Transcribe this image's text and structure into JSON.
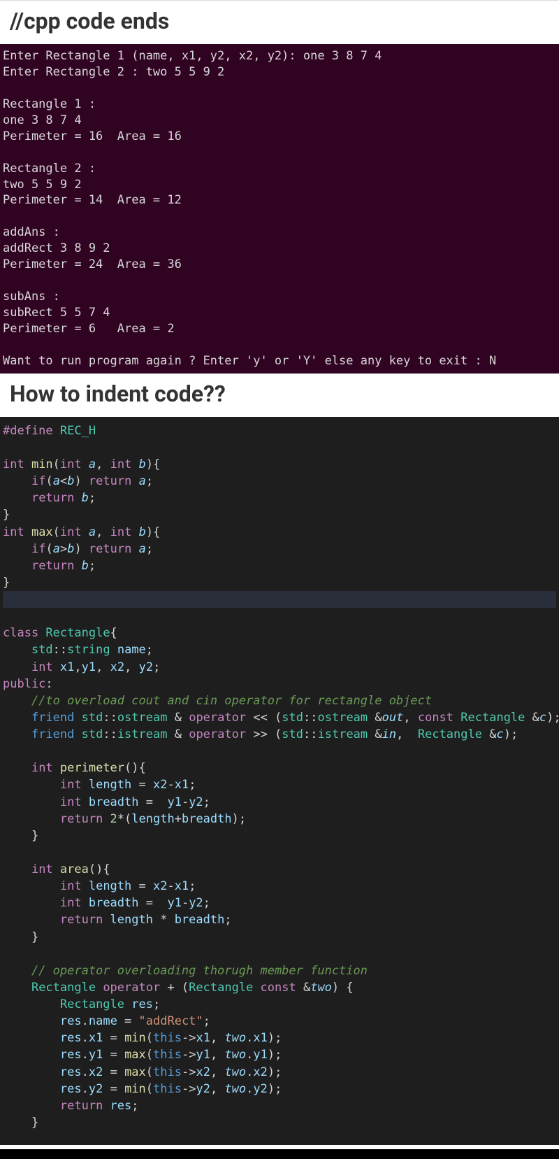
{
  "heading1": "//cpp code ends",
  "heading2": "How to indent code??",
  "terminal": {
    "lines": [
      "Enter Rectangle 1 (name, x1, y2, x2, y2): one 3 8 7 4",
      "Enter Rectangle 2 : two 5 5 9 2",
      "",
      "Rectangle 1 :",
      "one 3 8 7 4",
      "Perimeter = 16  Area = 16",
      "",
      "Rectangle 2 :",
      "two 5 5 9 2",
      "Perimeter = 14  Area = 12",
      "",
      "addAns :",
      "addRect 3 8 9 2",
      "Perimeter = 24  Area = 36",
      "",
      "subAns :",
      "subRect 5 5 7 4",
      "Perimeter = 6   Area = 2",
      "",
      "Want to run program again ? Enter 'y' or 'Y' else any key to exit : N"
    ]
  },
  "code": {
    "tokens": [
      [
        [
          "c-define",
          "#define "
        ],
        [
          "c-macro",
          "REC_H"
        ]
      ],
      [
        [
          "",
          ""
        ]
      ],
      [
        [
          "c-keyword",
          "int "
        ],
        [
          "c-func",
          "min"
        ],
        [
          "c-punct",
          "("
        ],
        [
          "c-keyword",
          "int "
        ],
        [
          "c-param",
          "a"
        ],
        [
          "c-punct",
          ", "
        ],
        [
          "c-keyword",
          "int "
        ],
        [
          "c-param",
          "b"
        ],
        [
          "c-punct",
          "){"
        ]
      ],
      [
        [
          "",
          "    "
        ],
        [
          "c-keyword",
          "if"
        ],
        [
          "c-punct",
          "("
        ],
        [
          "c-param",
          "a"
        ],
        [
          "c-op",
          "<"
        ],
        [
          "c-param",
          "b"
        ],
        [
          "c-punct",
          ") "
        ],
        [
          "c-keyword",
          "return "
        ],
        [
          "c-param",
          "a"
        ],
        [
          "c-punct",
          ";"
        ]
      ],
      [
        [
          "",
          "    "
        ],
        [
          "c-keyword",
          "return "
        ],
        [
          "c-param",
          "b"
        ],
        [
          "c-punct",
          ";"
        ]
      ],
      [
        [
          "c-punct",
          "}"
        ]
      ],
      [
        [
          "c-keyword",
          "int "
        ],
        [
          "c-func",
          "max"
        ],
        [
          "c-punct",
          "("
        ],
        [
          "c-keyword",
          "int "
        ],
        [
          "c-param",
          "a"
        ],
        [
          "c-punct",
          ", "
        ],
        [
          "c-keyword",
          "int "
        ],
        [
          "c-param",
          "b"
        ],
        [
          "c-punct",
          "){"
        ]
      ],
      [
        [
          "",
          "    "
        ],
        [
          "c-keyword",
          "if"
        ],
        [
          "c-punct",
          "("
        ],
        [
          "c-param",
          "a"
        ],
        [
          "c-op",
          ">"
        ],
        [
          "c-param",
          "b"
        ],
        [
          "c-punct",
          ") "
        ],
        [
          "c-keyword",
          "return "
        ],
        [
          "c-param",
          "a"
        ],
        [
          "c-punct",
          ";"
        ]
      ],
      [
        [
          "",
          "    "
        ],
        [
          "c-keyword",
          "return "
        ],
        [
          "c-param",
          "b"
        ],
        [
          "c-punct",
          ";"
        ]
      ],
      [
        [
          "c-punct",
          "}"
        ]
      ],
      [
        [
          "hl-line",
          ""
        ]
      ],
      [
        [
          "c-keyword",
          "class "
        ],
        [
          "c-type",
          "Rectangle"
        ],
        [
          "c-punct",
          "{"
        ]
      ],
      [
        [
          "",
          "    "
        ],
        [
          "c-ns",
          "std"
        ],
        [
          "c-punct",
          "::"
        ],
        [
          "c-type",
          "string"
        ],
        [
          "",
          " "
        ],
        [
          "c-var",
          "name"
        ],
        [
          "c-punct",
          ";"
        ]
      ],
      [
        [
          "",
          "    "
        ],
        [
          "c-keyword",
          "int "
        ],
        [
          "c-var",
          "x1"
        ],
        [
          "c-punct",
          ","
        ],
        [
          "c-var",
          "y1"
        ],
        [
          "c-punct",
          ", "
        ],
        [
          "c-var",
          "x2"
        ],
        [
          "c-punct",
          ", "
        ],
        [
          "c-var",
          "y2"
        ],
        [
          "c-punct",
          ";"
        ]
      ],
      [
        [
          "c-keyword",
          "public"
        ],
        [
          "c-punct",
          ":"
        ]
      ],
      [
        [
          "",
          "    "
        ],
        [
          "c-comment",
          "//to overload cout and cin operator for rectangle object"
        ]
      ],
      [
        [
          "",
          "    "
        ],
        [
          "c-friend",
          "friend "
        ],
        [
          "c-ns",
          "std"
        ],
        [
          "c-punct",
          "::"
        ],
        [
          "c-type",
          "ostream"
        ],
        [
          "",
          " "
        ],
        [
          "c-op",
          "& "
        ],
        [
          "c-keyword",
          "operator "
        ],
        [
          "c-op",
          "<< "
        ],
        [
          "c-punct",
          "("
        ],
        [
          "c-ns",
          "std"
        ],
        [
          "c-punct",
          "::"
        ],
        [
          "c-type",
          "ostream"
        ],
        [
          "",
          " "
        ],
        [
          "c-op",
          "&"
        ],
        [
          "c-param",
          "out"
        ],
        [
          "c-punct",
          ", "
        ],
        [
          "c-keyword",
          "const "
        ],
        [
          "c-type",
          "Rectangle"
        ],
        [
          "",
          " "
        ],
        [
          "c-op",
          "&"
        ],
        [
          "c-param",
          "c"
        ],
        [
          "c-punct",
          ");"
        ]
      ],
      [
        [
          "",
          "    "
        ],
        [
          "c-friend",
          "friend "
        ],
        [
          "c-ns",
          "std"
        ],
        [
          "c-punct",
          "::"
        ],
        [
          "c-type",
          "istream"
        ],
        [
          "",
          " "
        ],
        [
          "c-op",
          "& "
        ],
        [
          "c-keyword",
          "operator "
        ],
        [
          "c-op",
          ">> "
        ],
        [
          "c-punct",
          "("
        ],
        [
          "c-ns",
          "std"
        ],
        [
          "c-punct",
          "::"
        ],
        [
          "c-type",
          "istream"
        ],
        [
          "",
          " "
        ],
        [
          "c-op",
          "&"
        ],
        [
          "c-param",
          "in"
        ],
        [
          "c-punct",
          ",  "
        ],
        [
          "c-type",
          "Rectangle"
        ],
        [
          "",
          " "
        ],
        [
          "c-op",
          "&"
        ],
        [
          "c-param",
          "c"
        ],
        [
          "c-punct",
          ");"
        ]
      ],
      [
        [
          "",
          ""
        ]
      ],
      [
        [
          "",
          "    "
        ],
        [
          "c-keyword",
          "int "
        ],
        [
          "c-func",
          "perimeter"
        ],
        [
          "c-punct",
          "(){"
        ]
      ],
      [
        [
          "",
          "        "
        ],
        [
          "c-keyword",
          "int "
        ],
        [
          "c-var",
          "length"
        ],
        [
          "c-op",
          " = "
        ],
        [
          "c-var",
          "x2"
        ],
        [
          "c-op",
          "-"
        ],
        [
          "c-var",
          "x1"
        ],
        [
          "c-punct",
          ";"
        ]
      ],
      [
        [
          "",
          "        "
        ],
        [
          "c-keyword",
          "int "
        ],
        [
          "c-var",
          "breadth"
        ],
        [
          "c-op",
          " =  "
        ],
        [
          "c-var",
          "y1"
        ],
        [
          "c-op",
          "-"
        ],
        [
          "c-var",
          "y2"
        ],
        [
          "c-punct",
          ";"
        ]
      ],
      [
        [
          "",
          "        "
        ],
        [
          "c-keyword",
          "return "
        ],
        [
          "c-num",
          "2"
        ],
        [
          "c-op",
          "*"
        ],
        [
          "c-punct",
          "("
        ],
        [
          "c-var",
          "length"
        ],
        [
          "c-op",
          "+"
        ],
        [
          "c-var",
          "breadth"
        ],
        [
          "c-punct",
          ");"
        ]
      ],
      [
        [
          "",
          "    "
        ],
        [
          "c-punct",
          "}"
        ]
      ],
      [
        [
          "",
          ""
        ]
      ],
      [
        [
          "",
          "    "
        ],
        [
          "c-keyword",
          "int "
        ],
        [
          "c-func",
          "area"
        ],
        [
          "c-punct",
          "(){"
        ]
      ],
      [
        [
          "",
          "        "
        ],
        [
          "c-keyword",
          "int "
        ],
        [
          "c-var",
          "length"
        ],
        [
          "c-op",
          " = "
        ],
        [
          "c-var",
          "x2"
        ],
        [
          "c-op",
          "-"
        ],
        [
          "c-var",
          "x1"
        ],
        [
          "c-punct",
          ";"
        ]
      ],
      [
        [
          "",
          "        "
        ],
        [
          "c-keyword",
          "int "
        ],
        [
          "c-var",
          "breadth"
        ],
        [
          "c-op",
          " =  "
        ],
        [
          "c-var",
          "y1"
        ],
        [
          "c-op",
          "-"
        ],
        [
          "c-var",
          "y2"
        ],
        [
          "c-punct",
          ";"
        ]
      ],
      [
        [
          "",
          "        "
        ],
        [
          "c-keyword",
          "return "
        ],
        [
          "c-var",
          "length"
        ],
        [
          "c-op",
          " * "
        ],
        [
          "c-var",
          "breadth"
        ],
        [
          "c-punct",
          ";"
        ]
      ],
      [
        [
          "",
          "    "
        ],
        [
          "c-punct",
          "}"
        ]
      ],
      [
        [
          "",
          ""
        ]
      ],
      [
        [
          "",
          "    "
        ],
        [
          "c-comment",
          "// operator overloading thorugh member function"
        ]
      ],
      [
        [
          "",
          "    "
        ],
        [
          "c-type",
          "Rectangle "
        ],
        [
          "c-keyword",
          "operator "
        ],
        [
          "c-op",
          "+ "
        ],
        [
          "c-punct",
          "("
        ],
        [
          "c-type",
          "Rectangle "
        ],
        [
          "c-keyword",
          "const "
        ],
        [
          "c-op",
          "&"
        ],
        [
          "c-param",
          "two"
        ],
        [
          "c-punct",
          ") {"
        ]
      ],
      [
        [
          "",
          "        "
        ],
        [
          "c-type",
          "Rectangle "
        ],
        [
          "c-var",
          "res"
        ],
        [
          "c-punct",
          ";"
        ]
      ],
      [
        [
          "",
          "        "
        ],
        [
          "c-var",
          "res"
        ],
        [
          "c-punct",
          "."
        ],
        [
          "c-var",
          "name"
        ],
        [
          "c-op",
          " = "
        ],
        [
          "c-string",
          "\"addRect\""
        ],
        [
          "c-punct",
          ";"
        ]
      ],
      [
        [
          "",
          "        "
        ],
        [
          "c-var",
          "res"
        ],
        [
          "c-punct",
          "."
        ],
        [
          "c-var",
          "x1"
        ],
        [
          "c-op",
          " = "
        ],
        [
          "c-func",
          "min"
        ],
        [
          "c-punct",
          "("
        ],
        [
          "c-this",
          "this"
        ],
        [
          "c-op",
          "->"
        ],
        [
          "c-var",
          "x1"
        ],
        [
          "c-punct",
          ", "
        ],
        [
          "c-param",
          "two"
        ],
        [
          "c-punct",
          "."
        ],
        [
          "c-var",
          "x1"
        ],
        [
          "c-punct",
          ");"
        ]
      ],
      [
        [
          "",
          "        "
        ],
        [
          "c-var",
          "res"
        ],
        [
          "c-punct",
          "."
        ],
        [
          "c-var",
          "y1"
        ],
        [
          "c-op",
          " = "
        ],
        [
          "c-func",
          "max"
        ],
        [
          "c-punct",
          "("
        ],
        [
          "c-this",
          "this"
        ],
        [
          "c-op",
          "->"
        ],
        [
          "c-var",
          "y1"
        ],
        [
          "c-punct",
          ", "
        ],
        [
          "c-param",
          "two"
        ],
        [
          "c-punct",
          "."
        ],
        [
          "c-var",
          "y1"
        ],
        [
          "c-punct",
          ");"
        ]
      ],
      [
        [
          "",
          "        "
        ],
        [
          "c-var",
          "res"
        ],
        [
          "c-punct",
          "."
        ],
        [
          "c-var",
          "x2"
        ],
        [
          "c-op",
          " = "
        ],
        [
          "c-func",
          "max"
        ],
        [
          "c-punct",
          "("
        ],
        [
          "c-this",
          "this"
        ],
        [
          "c-op",
          "->"
        ],
        [
          "c-var",
          "x2"
        ],
        [
          "c-punct",
          ", "
        ],
        [
          "c-param",
          "two"
        ],
        [
          "c-punct",
          "."
        ],
        [
          "c-var",
          "x2"
        ],
        [
          "c-punct",
          ");"
        ]
      ],
      [
        [
          "",
          "        "
        ],
        [
          "c-var",
          "res"
        ],
        [
          "c-punct",
          "."
        ],
        [
          "c-var",
          "y2"
        ],
        [
          "c-op",
          " = "
        ],
        [
          "c-func",
          "min"
        ],
        [
          "c-punct",
          "("
        ],
        [
          "c-this",
          "this"
        ],
        [
          "c-op",
          "->"
        ],
        [
          "c-var",
          "y2"
        ],
        [
          "c-punct",
          ", "
        ],
        [
          "c-param",
          "two"
        ],
        [
          "c-punct",
          "."
        ],
        [
          "c-var",
          "y2"
        ],
        [
          "c-punct",
          ");"
        ]
      ],
      [
        [
          "",
          "        "
        ],
        [
          "c-keyword",
          "return "
        ],
        [
          "c-var",
          "res"
        ],
        [
          "c-punct",
          ";"
        ]
      ],
      [
        [
          "",
          "    "
        ],
        [
          "c-punct",
          "}"
        ]
      ]
    ]
  }
}
